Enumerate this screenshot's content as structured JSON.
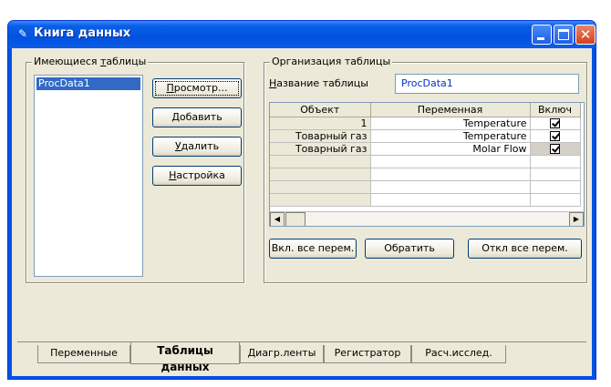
{
  "window": {
    "title": "Книга данных"
  },
  "tables_group": {
    "label_pre": "Имеющиеся ",
    "label_u": "т",
    "label_post": "аблицы",
    "items": [
      "ProcData1"
    ],
    "buttons": [
      {
        "pre": "",
        "u": "П",
        "post": "росмотр..."
      },
      {
        "pre": "",
        "u": "Д",
        "post": "обавить"
      },
      {
        "pre": "",
        "u": "У",
        "post": "далить"
      },
      {
        "pre": "",
        "u": "Н",
        "post": "астройка"
      }
    ]
  },
  "org_group": {
    "label": "Организация таблицы",
    "name_label_u": "Н",
    "name_label_post": "азвание таблицы",
    "name_value": "ProcData1",
    "columns": [
      "Объект",
      "Переменная",
      "Включ"
    ],
    "rows": [
      {
        "object": "1",
        "variable": "Temperature"
      },
      {
        "object": "Товарный газ",
        "variable": "Temperature"
      },
      {
        "object": "Товарный газ",
        "variable": "Molar Flow"
      }
    ],
    "buttons": [
      "Вкл. все перем.",
      "Обратить",
      "Откл все перем."
    ]
  },
  "tabs": [
    "Переменные",
    "Таблицы данных",
    "Диагр.ленты",
    "Регистратор",
    "Расч.исслед."
  ],
  "active_tab": "Таблицы данных"
}
